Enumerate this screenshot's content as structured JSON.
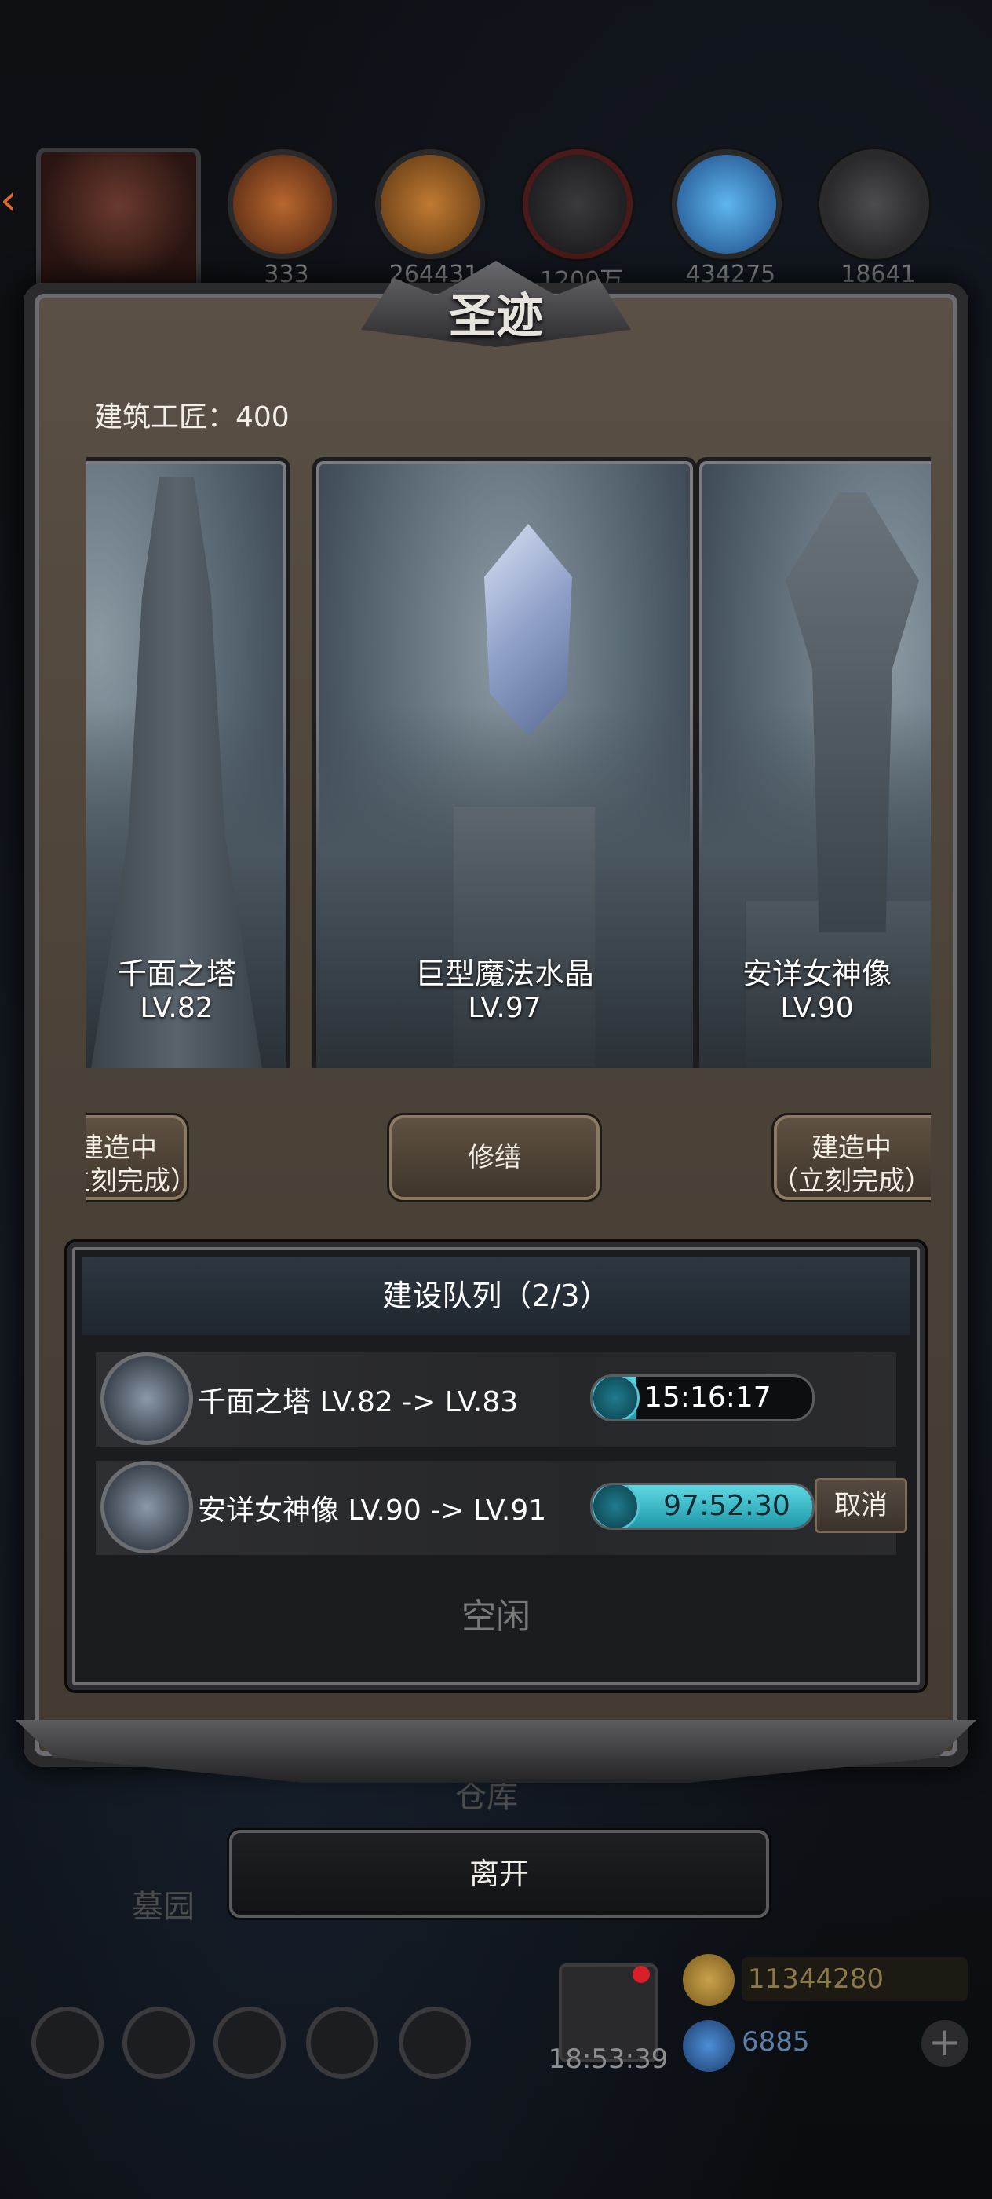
{
  "resources": {
    "items": [
      {
        "icon": "wood-log-icon",
        "value": "333",
        "color": "#a5552a"
      },
      {
        "icon": "plank-icon",
        "value": "264431",
        "color": "#a86a2c"
      },
      {
        "icon": "iron-ingot-icon",
        "value": "1200万",
        "color": "#3a3a3c"
      },
      {
        "icon": "blue-crystal-icon",
        "value": "434275",
        "color": "#2e8fd6"
      },
      {
        "icon": "steel-plate-icon",
        "value": "18641",
        "color": "#4a4a4c"
      }
    ]
  },
  "modal": {
    "title": "圣迹",
    "craftsman_label": "建筑工匠：400",
    "cards": [
      {
        "name": "千面之塔",
        "level": "LV.82"
      },
      {
        "name": "巨型魔法水晶",
        "level": "LV.97"
      },
      {
        "name": "安详女神像",
        "level": "LV.90"
      }
    ],
    "actions": [
      {
        "line1": "建造中",
        "line2": "（立刻完成）"
      },
      {
        "label": "修缮"
      },
      {
        "line1": "建造中",
        "line2": "（立刻完成）"
      }
    ],
    "queue": {
      "title": "建设队列（2/3）",
      "rows": [
        {
          "text": "千面之塔 LV.82 -> LV.83",
          "timer": "15:16:17",
          "progress": 0.2
        },
        {
          "text": "安详女神像 LV.90 -> LV.91",
          "timer": "97:52:30",
          "progress": 1.0,
          "cancel": "取消"
        }
      ],
      "idle": "空闲"
    },
    "leave": "离开"
  },
  "background": {
    "labels": {
      "warehouse": "仓库",
      "cemetery": "墓园"
    },
    "gift_timer": "18:53:39",
    "gold": "11344280",
    "gems": "6885",
    "plus": "+"
  }
}
